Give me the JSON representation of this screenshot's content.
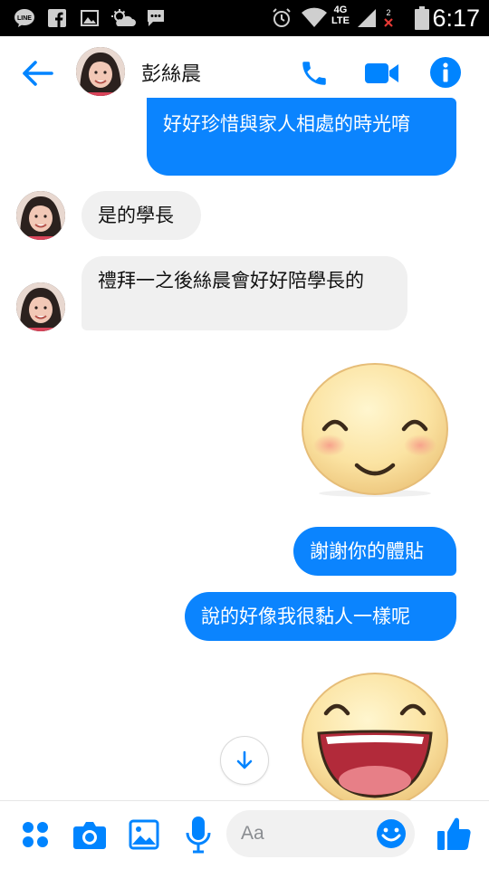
{
  "status_bar": {
    "time": "6:17",
    "network": "4G",
    "network_sub": "LTE",
    "sim_number": "2",
    "icons": [
      "line-app-icon",
      "facebook-icon",
      "gallery-icon",
      "weather-icon",
      "messenger-icon",
      "alarm-icon",
      "wifi-icon",
      "signal-icon",
      "battery-icon"
    ]
  },
  "header": {
    "contact_name": "彭絲晨",
    "back_icon": "back-arrow-icon",
    "call_icon": "phone-icon",
    "video_icon": "video-camera-icon",
    "info_icon": "info-icon"
  },
  "messages": [
    {
      "from": "me",
      "text": "好好珍惜與家人相處的時光唷"
    },
    {
      "from": "them",
      "text": "是的學長"
    },
    {
      "from": "them",
      "text": "禮拜一之後絲晨會好好陪學長的"
    },
    {
      "from": "me",
      "sticker": "smiling-blush-emoji"
    },
    {
      "from": "me",
      "text": "謝謝你的體貼"
    },
    {
      "from": "me",
      "text": "說的好像我很黏人一樣呢"
    },
    {
      "from": "me",
      "sticker": "laughing-emoji"
    }
  ],
  "composer": {
    "placeholder": "Aa"
  },
  "colors": {
    "accent": "#0084ff",
    "my_bubble": "#0b84fe",
    "their_bubble": "#f0f0f0",
    "status_bar": "#000000"
  }
}
